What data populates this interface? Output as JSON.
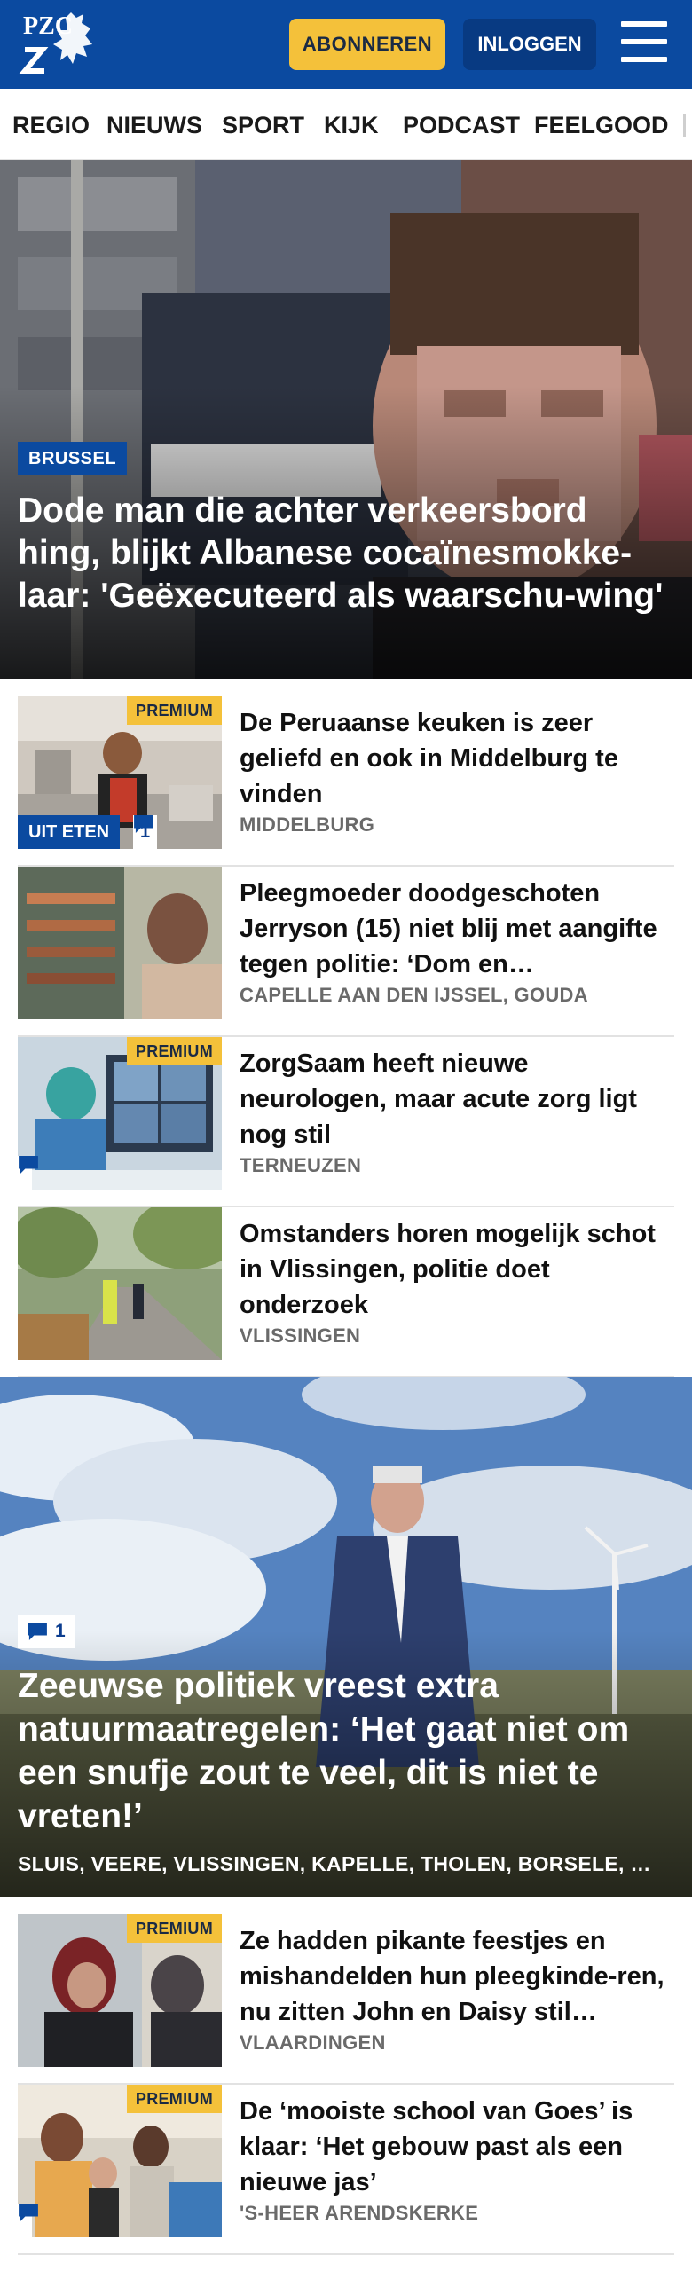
{
  "header": {
    "logo_letters": "PZC",
    "subscribe_label": "ABONNEREN",
    "login_label": "INLOGGEN",
    "menu_icon": "hamburger-menu-icon"
  },
  "nav": {
    "items": [
      "REGIO",
      "NIEUWS",
      "SPORT",
      "KIJK",
      "PODCAST",
      "FEELGOOD"
    ]
  },
  "hero": {
    "category": "BRUSSEL",
    "title": "Dode man die achter verkeersbord hing, blijkt Albanese cocaïnesmokke-laar: 'Geëxecuteerd als waarschu-wing'"
  },
  "articles_top": [
    {
      "title": "De Peruaanse keuken is zeer geliefd en ook in Middelburg te vinden",
      "location": "MIDDELBURG",
      "premium": "PREMIUM",
      "category": "UIT ETEN",
      "comments": "1"
    },
    {
      "title": "Pleegmoeder doodgeschoten Jerryson (15) niet blij met aangifte tegen politie: ‘Dom en…",
      "location": "CAPELLE AAN DEN IJSSEL, GOUDA"
    },
    {
      "title": "ZorgSaam heeft nieuwe neurologen, maar acute zorg ligt nog stil",
      "location": "TERNEUZEN",
      "premium": "PREMIUM"
    },
    {
      "title": "Omstanders horen mogelijk schot in Vlissingen, politie doet onderzoek",
      "location": "VLISSINGEN"
    }
  ],
  "feature": {
    "comments": "1",
    "title": "Zeeuwse politiek vreest extra natuurmaatregelen: ‘Het gaat niet om een snufje zout te veel, dit is niet te vreten!’",
    "locations": "SLUIS, VEERE, VLISSINGEN, KAPELLE, THOLEN, BORSELE, …"
  },
  "articles_bottom": [
    {
      "title": "Ze hadden pikante feestjes en mishandelden hun pleegkinde-ren, nu zitten John en Daisy stil…",
      "location": "VLAARDINGEN",
      "premium": "PREMIUM"
    },
    {
      "title": "De ‘mooiste school van Goes’ is klaar: ‘Het gebouw past als een nieuwe jas’",
      "location": "'S-HEER ARENDSKERKE",
      "premium": "PREMIUM"
    }
  ],
  "colors": {
    "brand_blue": "#0b4aa0",
    "premium_yellow": "#f4c13a",
    "location_gray": "#6a6a6a"
  }
}
